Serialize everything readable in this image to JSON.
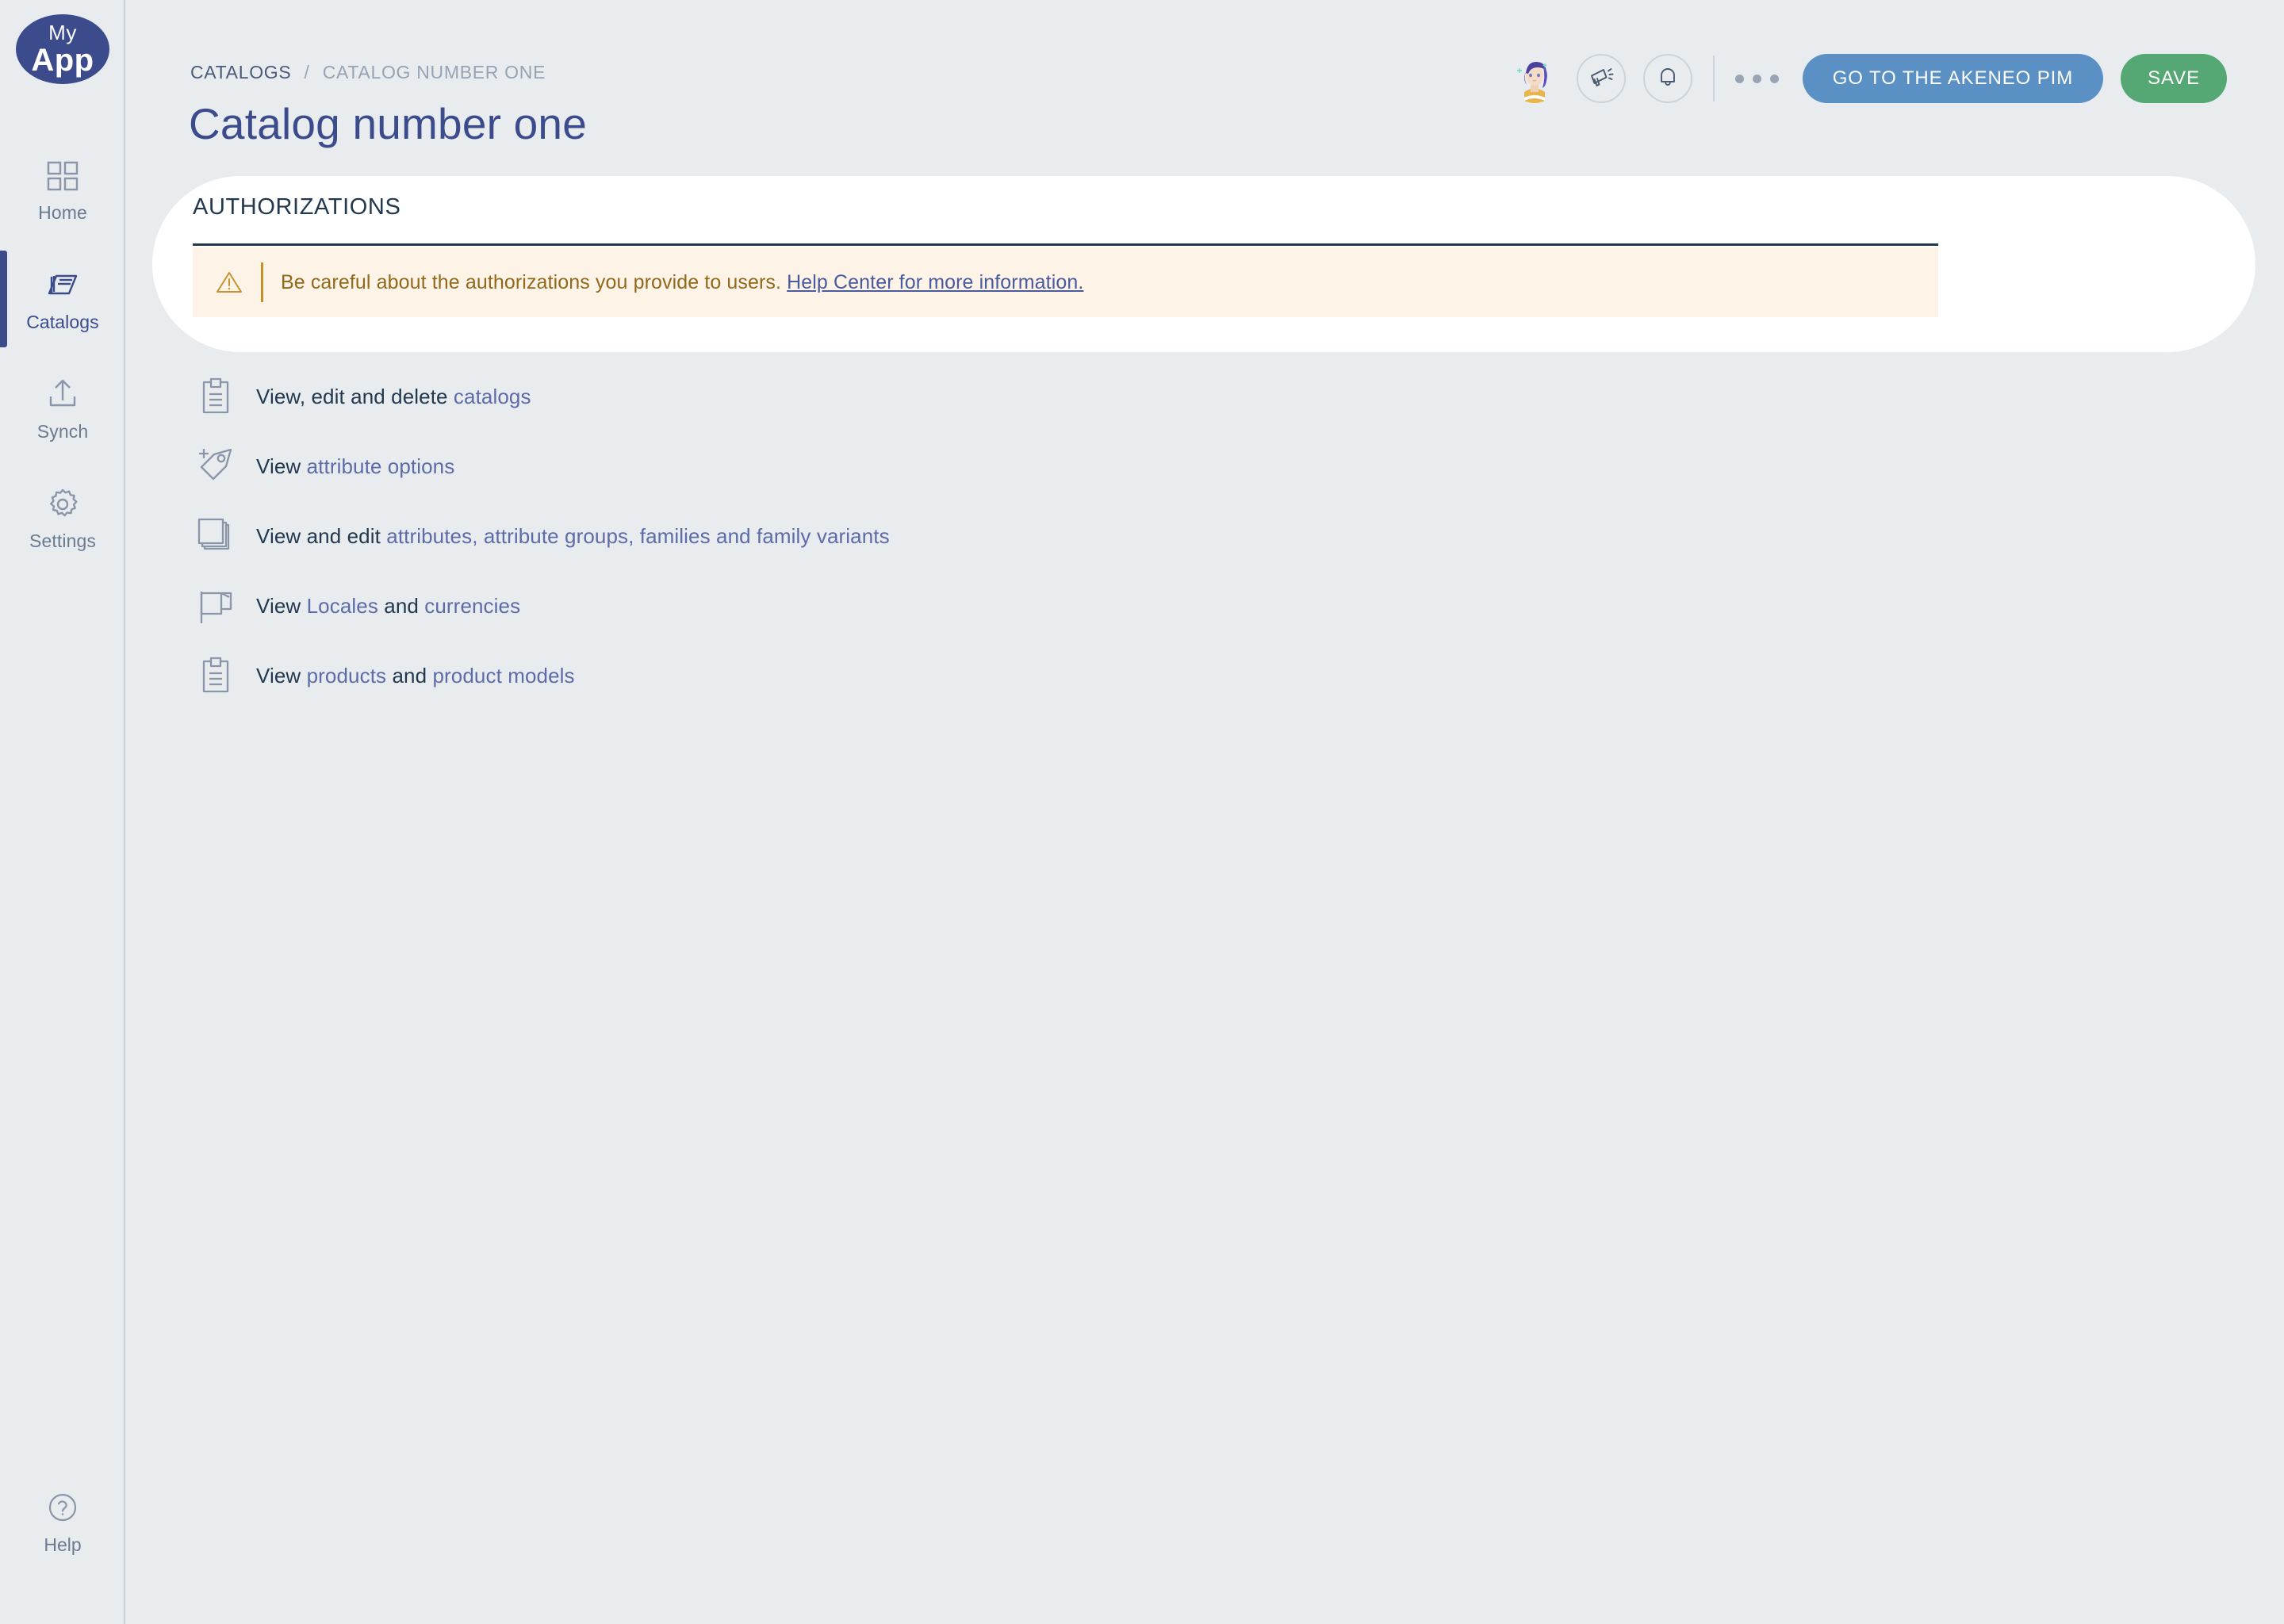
{
  "app": {
    "logo_line1": "My",
    "logo_line2": "App",
    "accent_blue": "#3b4b8c",
    "bg": "#e8ecef",
    "pim_button_color": "#5a90c4",
    "save_button_color": "#55a773",
    "warning_bg": "#fdf4e7",
    "warning_text_color": "#92681c",
    "link_color": "#5d6ba8"
  },
  "sidebar": {
    "items": [
      {
        "label": "Home",
        "icon": "grid-icon",
        "active": false
      },
      {
        "label": "Catalogs",
        "icon": "books-icon",
        "active": true
      },
      {
        "label": "Synch",
        "icon": "upload-icon",
        "active": false
      },
      {
        "label": "Settings",
        "icon": "gear-icon",
        "active": false
      }
    ],
    "help": {
      "label": "Help",
      "icon": "question-circle-icon"
    }
  },
  "header": {
    "breadcrumb": {
      "parent": "CATALOGS",
      "separator": "/",
      "current": "CATALOG NUMBER ONE"
    },
    "title": "Catalog number one",
    "avatar_alt": "user-avatar",
    "icons": [
      "megaphone-icon",
      "bell-icon",
      "ellipsis-icon"
    ],
    "pim_button_label": "GO TO THE AKENEO PIM",
    "save_button_label": "SAVE"
  },
  "main": {
    "section_title": "AUTHORIZATIONS",
    "warning": {
      "icon": "warning-triangle-icon",
      "text": "Be careful about the authorizations you provide to users.",
      "link_label": "Help Center for more information."
    },
    "authorizations": [
      {
        "icon": "clipboard-icon",
        "parts": [
          {
            "t": "View, edit and delete ",
            "link": false
          },
          {
            "t": "catalogs",
            "link": true
          }
        ]
      },
      {
        "icon": "tag-plus-icon",
        "parts": [
          {
            "t": "View ",
            "link": false
          },
          {
            "t": "attribute options",
            "link": true
          }
        ]
      },
      {
        "icon": "stacked-pages-icon",
        "parts": [
          {
            "t": "View and edit ",
            "link": false
          },
          {
            "t": "attributes, attribute groups, families and family variants",
            "link": true
          }
        ]
      },
      {
        "icon": "flag-icon",
        "parts": [
          {
            "t": "View ",
            "link": false
          },
          {
            "t": "Locales",
            "link": true
          },
          {
            "t": " and ",
            "link": false
          },
          {
            "t": "currencies",
            "link": true
          }
        ]
      },
      {
        "icon": "clipboard-icon",
        "parts": [
          {
            "t": "View ",
            "link": false
          },
          {
            "t": "products",
            "link": true
          },
          {
            "t": " and ",
            "link": false
          },
          {
            "t": "product models",
            "link": true
          }
        ]
      }
    ]
  }
}
